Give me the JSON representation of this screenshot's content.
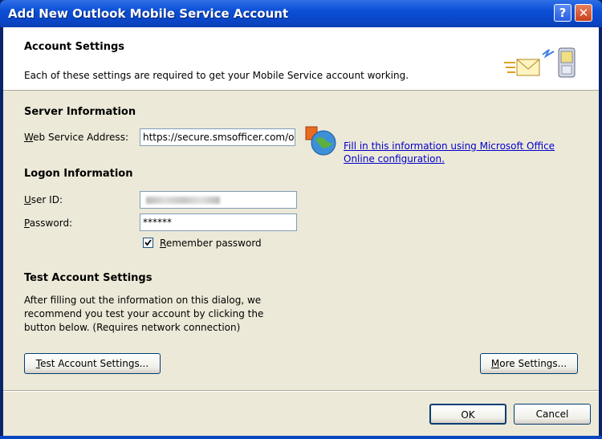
{
  "window": {
    "title": "Add New Outlook Mobile Service Account",
    "help_glyph": "?",
    "close_glyph": "✕"
  },
  "header": {
    "title": "Account Settings",
    "subtitle": "Each of these settings are required to get your Mobile Service account working.",
    "icon": "envelope-phone-icon"
  },
  "server": {
    "section_title": "Server Information",
    "web_service_label_pre": "",
    "web_service_label_mnemonic": "W",
    "web_service_label_post": "eb Service Address:",
    "web_service_value": "https://secure.smsofficer.com/o",
    "office_link": "Fill in this information using Microsoft Office Online configuration."
  },
  "logon": {
    "section_title": "Logon Information",
    "user_label_mnemonic": "U",
    "user_label_post": "ser ID:",
    "password_label_mnemonic": "P",
    "password_label_post": "assword:",
    "password_value": "******",
    "remember_mnemonic": "R",
    "remember_post": "emember password",
    "remember_checked": true
  },
  "test": {
    "section_title": "Test Account Settings",
    "description": "After filling out the information on this dialog, we recommend you test your account by clicking the button below. (Requires network connection)",
    "button_mnemonic": "T",
    "button_post": "est Account Settings...",
    "more_pre": "M",
    "more_post": "ore Settings..."
  },
  "footer": {
    "ok_label": "OK",
    "cancel_label": "Cancel"
  }
}
